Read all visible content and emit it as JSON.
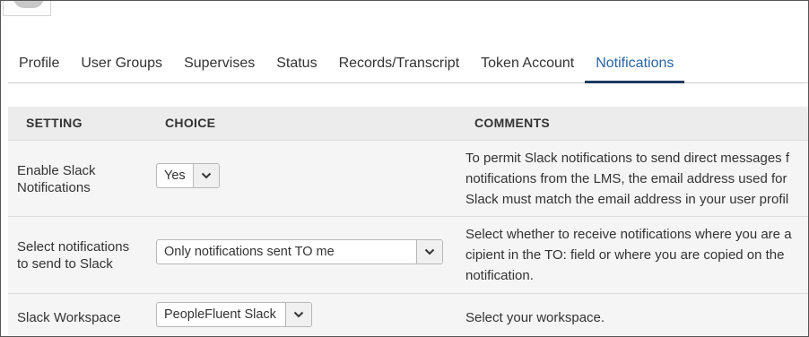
{
  "tabs": [
    {
      "label": "Profile"
    },
    {
      "label": "User Groups"
    },
    {
      "label": "Supervises"
    },
    {
      "label": "Status"
    },
    {
      "label": "Records/Transcript"
    },
    {
      "label": "Token Account"
    },
    {
      "label": "Notifications",
      "active": true
    }
  ],
  "table": {
    "headers": {
      "setting": "SETTING",
      "choice": "CHOICE",
      "comments": "COMMENTS"
    },
    "rows": [
      {
        "setting_lines": [
          "Enable Slack",
          "Notifications"
        ],
        "choice": "Yes",
        "comment_lines": [
          "To permit Slack notifications to send direct messages f",
          "notifications from the LMS, the email address used for",
          "Slack must match the email address in your user profil"
        ]
      },
      {
        "setting_lines": [
          "Select notifications",
          "to send to Slack"
        ],
        "choice": "Only notifications sent TO me",
        "comment_lines": [
          "Select whether to receive notifications where you are a",
          "cipient in the TO: field or where you are copied on the",
          "notification."
        ]
      },
      {
        "setting_lines": [
          "Slack Workspace"
        ],
        "choice": "PeopleFluent Slack",
        "comment_lines": [
          "Select your workspace."
        ]
      }
    ]
  },
  "icons": {
    "avatar": "avatar-icon",
    "dropdown": "chevron-down-icon"
  },
  "colors": {
    "active_tab_text": "#2a64a4",
    "active_tab_underline": "#1f3a5f",
    "header_bg": "#ececec",
    "row_bg": "#f5f5f5"
  }
}
